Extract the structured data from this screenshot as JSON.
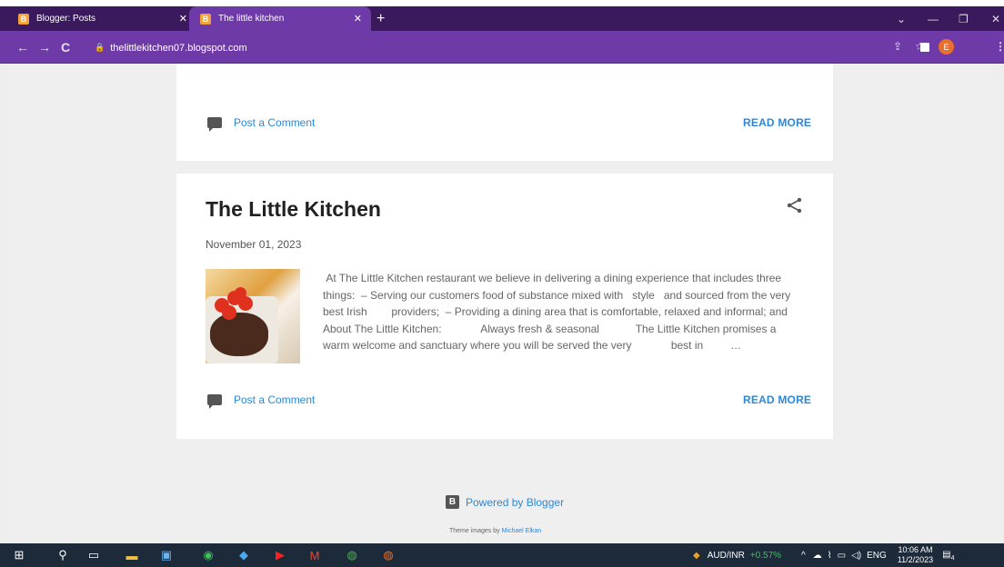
{
  "browser": {
    "tabs": [
      {
        "label": "Blogger: Posts",
        "favicon": "B"
      },
      {
        "label": "The little kitchen",
        "favicon": "B"
      }
    ],
    "new_tab": "+",
    "url": "thelittlekitchen07.blogspot.com",
    "profile_initial": "E"
  },
  "post_prev": {
    "comment_label": "Post a Comment",
    "read_more": "READ MORE"
  },
  "post": {
    "title": "The Little Kitchen",
    "date": "November 01, 2023",
    "snippet": " At The Little Kitchen restaurant we believe in delivering a dining experience that includes three things:  – Serving our customers food of substance mixed with   style   and sourced from the very best Irish        providers;  – Providing a dining area that is comfortable, relaxed and informal; and  About The Little Kitchen:             Always fresh & seasonal            The Little Kitchen promises a warm welcome and sanctuary where you will be served the very             best in         …",
    "comment_label": "Post a Comment",
    "read_more": "READ MORE"
  },
  "footer": {
    "powered_by": "Powered by Blogger",
    "blogger_icon": "B",
    "theme_prefix": "Theme images by",
    "theme_author": "Michael Elkan"
  },
  "taskbar": {
    "ticker": "AUD/INR",
    "ticker_change": "+0.57%",
    "language": "ENG",
    "time": "10:06 AM",
    "date": "11/2/2023",
    "notification_count": "4"
  },
  "colors": {
    "tab_strip": "#3a1a5c",
    "toolbar": "#6e3aa8",
    "link": "#2b88d8",
    "ticker_positive": "#3cc35a"
  }
}
